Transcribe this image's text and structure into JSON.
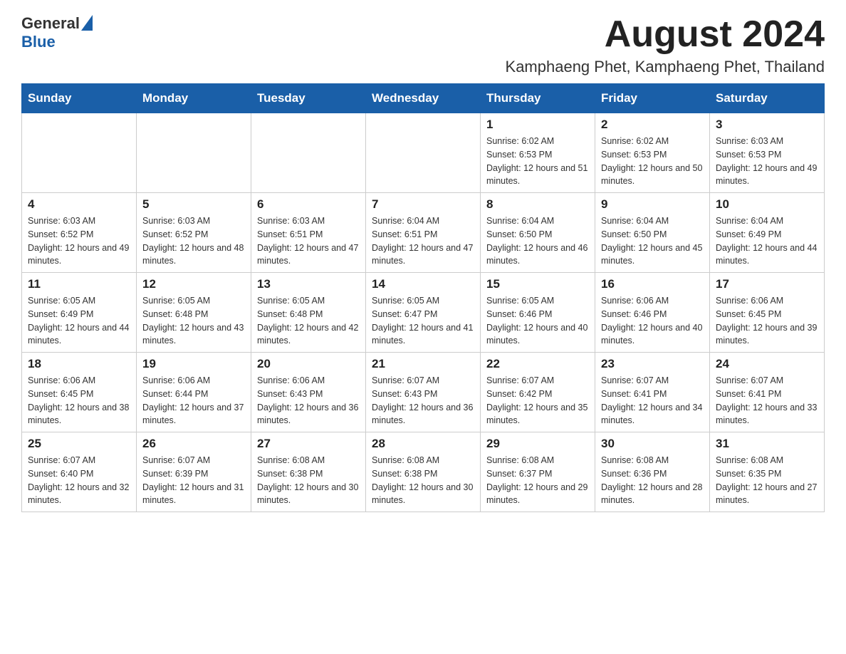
{
  "header": {
    "logo_general": "General",
    "logo_blue": "Blue",
    "month_title": "August 2024",
    "location": "Kamphaeng Phet, Kamphaeng Phet, Thailand"
  },
  "weekdays": [
    "Sunday",
    "Monday",
    "Tuesday",
    "Wednesday",
    "Thursday",
    "Friday",
    "Saturday"
  ],
  "weeks": [
    {
      "days": [
        {
          "num": "",
          "sunrise": "",
          "sunset": "",
          "daylight": ""
        },
        {
          "num": "",
          "sunrise": "",
          "sunset": "",
          "daylight": ""
        },
        {
          "num": "",
          "sunrise": "",
          "sunset": "",
          "daylight": ""
        },
        {
          "num": "",
          "sunrise": "",
          "sunset": "",
          "daylight": ""
        },
        {
          "num": "1",
          "sunrise": "Sunrise: 6:02 AM",
          "sunset": "Sunset: 6:53 PM",
          "daylight": "Daylight: 12 hours and 51 minutes."
        },
        {
          "num": "2",
          "sunrise": "Sunrise: 6:02 AM",
          "sunset": "Sunset: 6:53 PM",
          "daylight": "Daylight: 12 hours and 50 minutes."
        },
        {
          "num": "3",
          "sunrise": "Sunrise: 6:03 AM",
          "sunset": "Sunset: 6:53 PM",
          "daylight": "Daylight: 12 hours and 49 minutes."
        }
      ]
    },
    {
      "days": [
        {
          "num": "4",
          "sunrise": "Sunrise: 6:03 AM",
          "sunset": "Sunset: 6:52 PM",
          "daylight": "Daylight: 12 hours and 49 minutes."
        },
        {
          "num": "5",
          "sunrise": "Sunrise: 6:03 AM",
          "sunset": "Sunset: 6:52 PM",
          "daylight": "Daylight: 12 hours and 48 minutes."
        },
        {
          "num": "6",
          "sunrise": "Sunrise: 6:03 AM",
          "sunset": "Sunset: 6:51 PM",
          "daylight": "Daylight: 12 hours and 47 minutes."
        },
        {
          "num": "7",
          "sunrise": "Sunrise: 6:04 AM",
          "sunset": "Sunset: 6:51 PM",
          "daylight": "Daylight: 12 hours and 47 minutes."
        },
        {
          "num": "8",
          "sunrise": "Sunrise: 6:04 AM",
          "sunset": "Sunset: 6:50 PM",
          "daylight": "Daylight: 12 hours and 46 minutes."
        },
        {
          "num": "9",
          "sunrise": "Sunrise: 6:04 AM",
          "sunset": "Sunset: 6:50 PM",
          "daylight": "Daylight: 12 hours and 45 minutes."
        },
        {
          "num": "10",
          "sunrise": "Sunrise: 6:04 AM",
          "sunset": "Sunset: 6:49 PM",
          "daylight": "Daylight: 12 hours and 44 minutes."
        }
      ]
    },
    {
      "days": [
        {
          "num": "11",
          "sunrise": "Sunrise: 6:05 AM",
          "sunset": "Sunset: 6:49 PM",
          "daylight": "Daylight: 12 hours and 44 minutes."
        },
        {
          "num": "12",
          "sunrise": "Sunrise: 6:05 AM",
          "sunset": "Sunset: 6:48 PM",
          "daylight": "Daylight: 12 hours and 43 minutes."
        },
        {
          "num": "13",
          "sunrise": "Sunrise: 6:05 AM",
          "sunset": "Sunset: 6:48 PM",
          "daylight": "Daylight: 12 hours and 42 minutes."
        },
        {
          "num": "14",
          "sunrise": "Sunrise: 6:05 AM",
          "sunset": "Sunset: 6:47 PM",
          "daylight": "Daylight: 12 hours and 41 minutes."
        },
        {
          "num": "15",
          "sunrise": "Sunrise: 6:05 AM",
          "sunset": "Sunset: 6:46 PM",
          "daylight": "Daylight: 12 hours and 40 minutes."
        },
        {
          "num": "16",
          "sunrise": "Sunrise: 6:06 AM",
          "sunset": "Sunset: 6:46 PM",
          "daylight": "Daylight: 12 hours and 40 minutes."
        },
        {
          "num": "17",
          "sunrise": "Sunrise: 6:06 AM",
          "sunset": "Sunset: 6:45 PM",
          "daylight": "Daylight: 12 hours and 39 minutes."
        }
      ]
    },
    {
      "days": [
        {
          "num": "18",
          "sunrise": "Sunrise: 6:06 AM",
          "sunset": "Sunset: 6:45 PM",
          "daylight": "Daylight: 12 hours and 38 minutes."
        },
        {
          "num": "19",
          "sunrise": "Sunrise: 6:06 AM",
          "sunset": "Sunset: 6:44 PM",
          "daylight": "Daylight: 12 hours and 37 minutes."
        },
        {
          "num": "20",
          "sunrise": "Sunrise: 6:06 AM",
          "sunset": "Sunset: 6:43 PM",
          "daylight": "Daylight: 12 hours and 36 minutes."
        },
        {
          "num": "21",
          "sunrise": "Sunrise: 6:07 AM",
          "sunset": "Sunset: 6:43 PM",
          "daylight": "Daylight: 12 hours and 36 minutes."
        },
        {
          "num": "22",
          "sunrise": "Sunrise: 6:07 AM",
          "sunset": "Sunset: 6:42 PM",
          "daylight": "Daylight: 12 hours and 35 minutes."
        },
        {
          "num": "23",
          "sunrise": "Sunrise: 6:07 AM",
          "sunset": "Sunset: 6:41 PM",
          "daylight": "Daylight: 12 hours and 34 minutes."
        },
        {
          "num": "24",
          "sunrise": "Sunrise: 6:07 AM",
          "sunset": "Sunset: 6:41 PM",
          "daylight": "Daylight: 12 hours and 33 minutes."
        }
      ]
    },
    {
      "days": [
        {
          "num": "25",
          "sunrise": "Sunrise: 6:07 AM",
          "sunset": "Sunset: 6:40 PM",
          "daylight": "Daylight: 12 hours and 32 minutes."
        },
        {
          "num": "26",
          "sunrise": "Sunrise: 6:07 AM",
          "sunset": "Sunset: 6:39 PM",
          "daylight": "Daylight: 12 hours and 31 minutes."
        },
        {
          "num": "27",
          "sunrise": "Sunrise: 6:08 AM",
          "sunset": "Sunset: 6:38 PM",
          "daylight": "Daylight: 12 hours and 30 minutes."
        },
        {
          "num": "28",
          "sunrise": "Sunrise: 6:08 AM",
          "sunset": "Sunset: 6:38 PM",
          "daylight": "Daylight: 12 hours and 30 minutes."
        },
        {
          "num": "29",
          "sunrise": "Sunrise: 6:08 AM",
          "sunset": "Sunset: 6:37 PM",
          "daylight": "Daylight: 12 hours and 29 minutes."
        },
        {
          "num": "30",
          "sunrise": "Sunrise: 6:08 AM",
          "sunset": "Sunset: 6:36 PM",
          "daylight": "Daylight: 12 hours and 28 minutes."
        },
        {
          "num": "31",
          "sunrise": "Sunrise: 6:08 AM",
          "sunset": "Sunset: 6:35 PM",
          "daylight": "Daylight: 12 hours and 27 minutes."
        }
      ]
    }
  ]
}
